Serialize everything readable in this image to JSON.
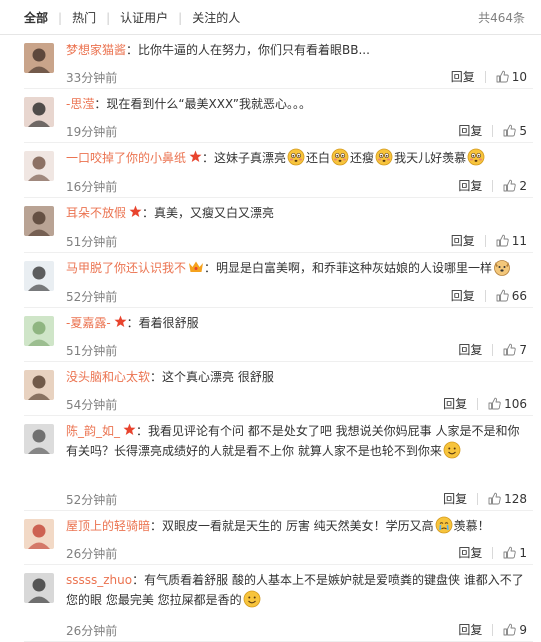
{
  "header": {
    "tabs": [
      {
        "label": "全部",
        "active": true
      },
      {
        "label": "热门",
        "active": false
      },
      {
        "label": "认证用户",
        "active": false
      },
      {
        "label": "关注的人",
        "active": false
      }
    ],
    "total": "共464条"
  },
  "colors": {
    "username": "#eb7350",
    "star": "#e8442e",
    "emoji": "#f7c43c"
  },
  "reply_label": "回复",
  "comments": [
    {
      "user": "梦想家猫酱",
      "parts": [
        "：比你牛逼的人在努力，你们只有看着眼BB..."
      ],
      "time": "33分钟前",
      "likes": "10",
      "badge": ""
    },
    {
      "user": "-思滢",
      "parts": [
        "：现在看到什么“最美XXX”我就恶心。。。"
      ],
      "time": "19分钟前",
      "likes": "5",
      "badge": ""
    },
    {
      "user": "一口咬掉了你的小鼻纸",
      "parts": [
        "：这妹子真漂亮",
        "还白",
        "还瘦",
        "我天儿好羡慕"
      ],
      "time": "16分钟前",
      "likes": "2",
      "badge": "star"
    },
    {
      "user": "耳朵不放假",
      "parts": [
        "：真美，又瘦又白又漂亮"
      ],
      "time": "51分钟前",
      "likes": "11",
      "badge": "star"
    },
    {
      "user": "马甲脱了你还认识我不",
      "parts": [
        "：明显是白富美啊，和乔菲这种灰姑娘的人设哪里一样"
      ],
      "time": "52分钟前",
      "likes": "66",
      "badge": "crown"
    },
    {
      "user": "-夏嘉露-",
      "parts": [
        "：看着很舒服"
      ],
      "time": "51分钟前",
      "likes": "7",
      "badge": "star"
    },
    {
      "user": "没头脑和心太软",
      "parts": [
        "：这个真心漂亮 很舒服"
      ],
      "time": "54分钟前",
      "likes": "106",
      "badge": ""
    },
    {
      "user": "陈_韵_如_",
      "parts": [
        "：我看见评论有个问 都不是处女了吧 我想说关你妈屁事 人家是不是和你有关吗？长得漂亮成绩好的人就是看不上你 就算人家不是也轮不到你来",
        ""
      ],
      "time": "52分钟前",
      "likes": "128",
      "badge": "star"
    },
    {
      "user": "屋顶上的轻骑暗",
      "parts": [
        "：双眼皮一看就是天生的 厉害 纯天然美女！学历又高",
        "羡慕！"
      ],
      "time": "26分钟前",
      "likes": "1",
      "badge": ""
    },
    {
      "user": "sssss_zhuo",
      "parts": [
        "：有气质看着舒服 酸的人基本上不是嫉妒就是爱喷粪的键盘侠 谁都入不了您的眼 您最完美 您拉屎都是香的",
        ""
      ],
      "time": "26分钟前",
      "likes": "9",
      "badge": ""
    }
  ]
}
